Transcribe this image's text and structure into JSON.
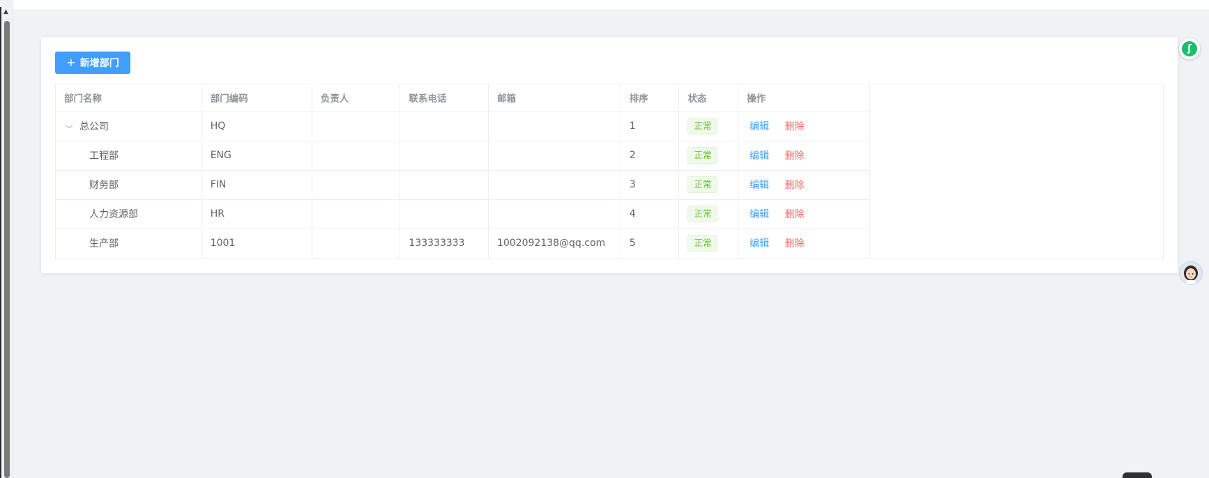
{
  "toolbar": {
    "add_label": "新增部门"
  },
  "table": {
    "headers": [
      "部门名称",
      "部门编码",
      "负责人",
      "联系电话",
      "邮箱",
      "排序",
      "状态",
      "操作"
    ],
    "rows": [
      {
        "name": "总公司",
        "code": "HQ",
        "leader": "",
        "phone": "",
        "email": "",
        "sort": "1",
        "status": "正常",
        "edit": "编辑",
        "del": "删除"
      },
      {
        "name": "工程部",
        "code": "ENG",
        "leader": "",
        "phone": "",
        "email": "",
        "sort": "2",
        "status": "正常",
        "edit": "编辑",
        "del": "删除"
      },
      {
        "name": "财务部",
        "code": "FIN",
        "leader": "",
        "phone": "",
        "email": "",
        "sort": "3",
        "status": "正常",
        "edit": "编辑",
        "del": "删除"
      },
      {
        "name": "人力资源部",
        "code": "HR",
        "leader": "",
        "phone": "",
        "email": "",
        "sort": "4",
        "status": "正常",
        "edit": "编辑",
        "del": "删除"
      },
      {
        "name": "生产部",
        "code": "1001",
        "leader": "",
        "phone": "133333333",
        "email": "1002092138@qq.com",
        "sort": "5",
        "status": "正常",
        "edit": "编辑",
        "del": "删除"
      }
    ]
  },
  "icons": {
    "add": "plus-icon",
    "expand": "chevron-down-icon",
    "float_logo": "logo-icon",
    "float_avatar": "avatar-icon"
  },
  "colors": {
    "primary": "#409eff",
    "danger": "#f56c6c",
    "success": "#67c23a",
    "background": "#f0f2f5"
  }
}
